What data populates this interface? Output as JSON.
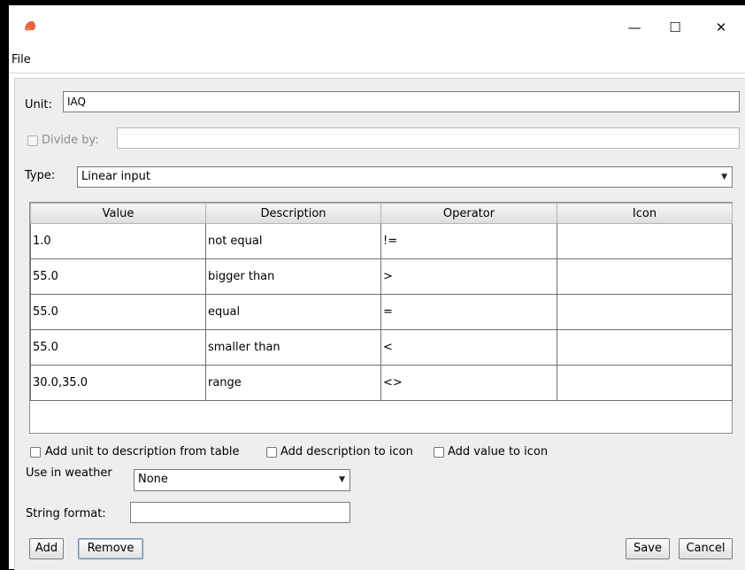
{
  "window": {
    "controls": {
      "minimize": "—",
      "maximize": "☐",
      "close": "✕"
    }
  },
  "menu": {
    "file": "File"
  },
  "form": {
    "unit_label": "Unit:",
    "unit_value": "IAQ",
    "divide_label": "Divide by:",
    "divide_value": "",
    "divide_checked": false,
    "type_label": "Type:",
    "type_value": "Linear input"
  },
  "table": {
    "columns": [
      "Value",
      "Description",
      "Operator",
      "Icon"
    ],
    "rows": [
      {
        "value": "1.0",
        "description": "not equal",
        "operator": "!=",
        "icon": ""
      },
      {
        "value": "55.0",
        "description": "bigger than",
        "operator": ">",
        "icon": ""
      },
      {
        "value": "55.0",
        "description": "equal",
        "operator": "=",
        "icon": ""
      },
      {
        "value": "55.0",
        "description": "smaller than",
        "operator": "<",
        "icon": ""
      },
      {
        "value": "30.0,35.0",
        "description": "range",
        "operator": "<>",
        "icon": ""
      }
    ]
  },
  "options": {
    "add_unit_label": "Add unit to description from table",
    "add_description_label": "Add description to icon",
    "add_value_label": "Add value to icon",
    "weather_label": "Use in weather",
    "weather_value": "None",
    "string_format_label": "String format:",
    "string_format_value": ""
  },
  "buttons": {
    "add": "Add",
    "remove": "Remove",
    "save": "Save",
    "cancel": "Cancel"
  },
  "colors": {
    "app_icon": "#e8643c",
    "window_bg": "#eeeeee"
  }
}
